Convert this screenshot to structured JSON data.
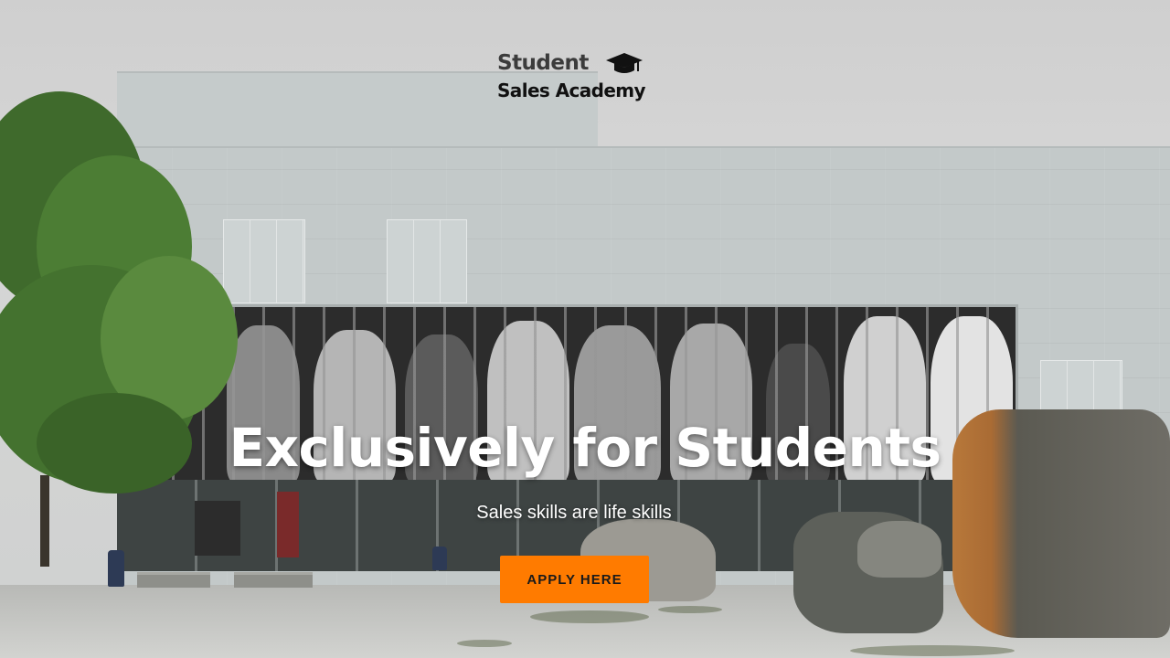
{
  "brand": {
    "line1": "Student",
    "line2": "Sales Academy",
    "icon": "graduation-cap-icon"
  },
  "hero": {
    "headline": "Exclusively for Students",
    "subheadline": "Sales skills are life skills",
    "cta_label": "APPLY HERE"
  },
  "colors": {
    "cta_background": "#ff7b00",
    "headline_text": "#ffffff",
    "logo_text": "#111111"
  }
}
